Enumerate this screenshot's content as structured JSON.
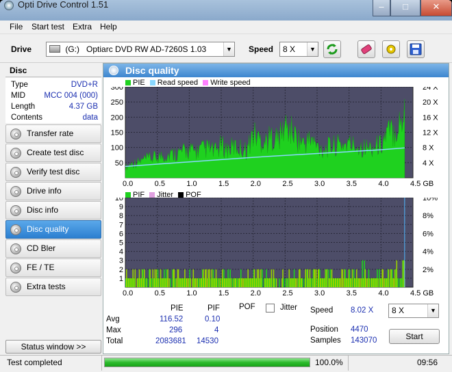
{
  "window": {
    "title": "Opti Drive Control 1.51"
  },
  "menu": [
    "File",
    "Start test",
    "Extra",
    "Help"
  ],
  "toolbar": {
    "drive_label": "Drive",
    "drive_letter": "(G:)",
    "drive_name": "Optiarc DVD RW AD-7260S 1.03",
    "speed_label": "Speed",
    "speed_value": "8 X"
  },
  "disc": {
    "header": "Disc",
    "fields": [
      {
        "k": "Type",
        "v": "DVD+R"
      },
      {
        "k": "MID",
        "v": "MCC 004 (000)"
      },
      {
        "k": "Length",
        "v": "4.37 GB"
      },
      {
        "k": "Contents",
        "v": "data"
      }
    ]
  },
  "nav": [
    "Transfer rate",
    "Create test disc",
    "Verify test disc",
    "Drive info",
    "Disc info",
    "Disc quality",
    "CD Bler",
    "FE / TE",
    "Extra tests"
  ],
  "nav_active": 5,
  "status_window_label": "Status window >>",
  "panel": {
    "title": "Disc quality"
  },
  "chart1_legend": [
    "PIE",
    "Read speed",
    "Write speed"
  ],
  "chart2_legend": [
    "PIF",
    "Jitter",
    "POF"
  ],
  "colors": {
    "pie": "#1fd11f",
    "pif": "#9ad200",
    "read": "#8ad8ff",
    "write": "#ff80ff",
    "jitter": "#e0a0e0",
    "pof": "#000000",
    "grid_bg": "#4d4d68",
    "accent": "#3d86cf"
  },
  "chart_data": [
    {
      "type": "area",
      "x_ticks": [
        "0.0",
        "0.5",
        "1.0",
        "1.5",
        "2.0",
        "2.5",
        "3.0",
        "3.5",
        "4.0",
        "4.5 GB"
      ],
      "y_ticks_left": [
        "300",
        "250",
        "200",
        "150",
        "100",
        "50"
      ],
      "y_ticks_right": [
        "24 X",
        "20 X",
        "16 X",
        "12 X",
        "8 X",
        "4 X"
      ],
      "xlim": [
        0,
        4.5
      ],
      "ylim": [
        0,
        300
      ],
      "y2lim": [
        0,
        24
      ],
      "series": [
        {
          "name": "PIE",
          "x": [
            0.0,
            0.1,
            0.2,
            0.3,
            0.4,
            0.5,
            0.6,
            0.7,
            0.8,
            0.9,
            1.0,
            1.1,
            1.2,
            1.3,
            1.4,
            1.5,
            1.6,
            1.7,
            1.8,
            1.9,
            2.0,
            2.1,
            2.2,
            2.3,
            2.4,
            2.5,
            2.6,
            2.7,
            2.8,
            2.9,
            3.0,
            3.1,
            3.2,
            3.3,
            3.4,
            3.5,
            3.6,
            3.7,
            3.8,
            3.9,
            4.0,
            4.1,
            4.2,
            4.3,
            4.37
          ],
          "y": [
            40,
            55,
            60,
            70,
            75,
            80,
            85,
            90,
            95,
            100,
            105,
            100,
            110,
            115,
            100,
            125,
            110,
            120,
            115,
            105,
            170,
            150,
            140,
            160,
            150,
            200,
            180,
            150,
            130,
            150,
            120,
            110,
            120,
            125,
            130,
            130,
            125,
            120,
            115,
            120,
            130,
            175,
            180,
            210,
            260
          ]
        },
        {
          "name": "Read speed",
          "x": [
            0.0,
            0.5,
            1.0,
            1.5,
            2.0,
            2.5,
            3.0,
            3.5,
            4.0,
            4.37
          ],
          "y": [
            3.0,
            3.6,
            4.2,
            4.8,
            5.4,
            5.9,
            6.4,
            6.9,
            7.4,
            7.9
          ]
        }
      ]
    },
    {
      "type": "bar",
      "x_ticks": [
        "0.0",
        "0.5",
        "1.0",
        "1.5",
        "2.0",
        "2.5",
        "3.0",
        "3.5",
        "4.0",
        "4.5 GB"
      ],
      "y_ticks_left": [
        "10",
        "9",
        "8",
        "7",
        "6",
        "5",
        "4",
        "3",
        "2",
        "1"
      ],
      "y_ticks_right": [
        "10%",
        "8%",
        "6%",
        "4%",
        "2%"
      ],
      "xlim": [
        0,
        4.5
      ],
      "ylim": [
        0,
        10
      ],
      "y2lim": [
        0,
        10
      ],
      "series": [
        {
          "name": "PIF",
          "x": [
            0.0,
            0.2,
            0.4,
            0.6,
            0.8,
            1.0,
            1.2,
            1.4,
            1.6,
            1.8,
            2.0,
            2.2,
            2.4,
            2.6,
            2.8,
            3.0,
            3.2,
            3.4,
            3.6,
            3.8,
            4.0,
            4.2,
            4.37
          ],
          "y": [
            1,
            2,
            1,
            2,
            1,
            1,
            2,
            1,
            2,
            1,
            2,
            2,
            1,
            2,
            2,
            2,
            1,
            2,
            3,
            2,
            2,
            3,
            4
          ]
        }
      ]
    }
  ],
  "stats": {
    "col_pie": "PIE",
    "col_pif": "PIF",
    "col_pof": "POF",
    "jitter_label": "Jitter",
    "rows": [
      {
        "label": "Avg",
        "pie": "116.52",
        "pif": "0.10"
      },
      {
        "label": "Max",
        "pie": "296",
        "pif": "4"
      },
      {
        "label": "Total",
        "pie": "2083681",
        "pif": "14530"
      }
    ],
    "speed_label": "Speed",
    "speed_value": "8.02 X",
    "speed_select": "8 X",
    "position_label": "Position",
    "position_value": "4470",
    "samples_label": "Samples",
    "samples_value": "143070",
    "start_label": "Start"
  },
  "status": {
    "text": "Test completed",
    "progress": 1.0,
    "percent": "100.0%",
    "time": "09:56"
  }
}
